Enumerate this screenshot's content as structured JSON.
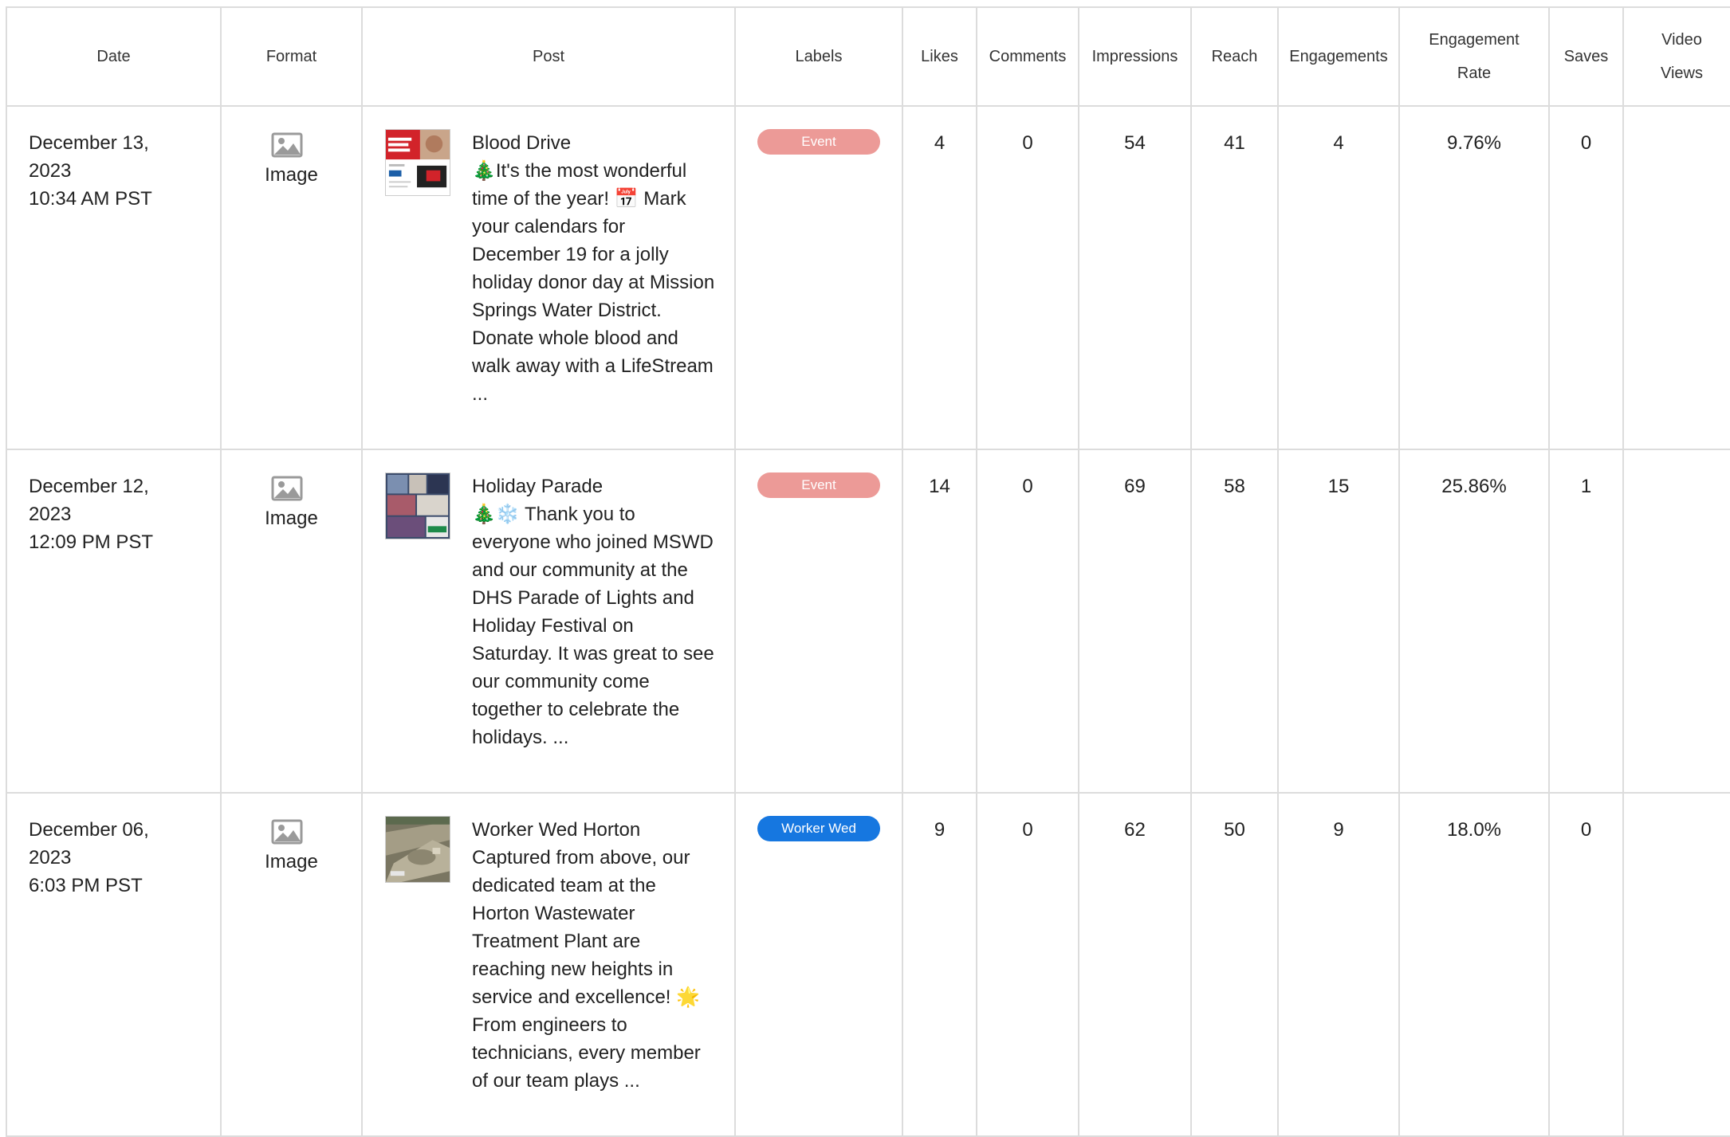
{
  "columns": {
    "date": "Date",
    "format": "Format",
    "post": "Post",
    "labels": "Labels",
    "likes": "Likes",
    "comments": "Comments",
    "impressions": "Impressions",
    "reach": "Reach",
    "engagements": "Engagements",
    "engagement_rate_line1": "Engagement",
    "engagement_rate_line2": "Rate",
    "saves": "Saves",
    "video_views_line1": "Video",
    "video_views_line2": "Views"
  },
  "colors": {
    "event_badge": "#ec9a97",
    "worker_wed_badge": "#1677e0"
  },
  "rows": [
    {
      "date": "December 13,",
      "year": "2023",
      "time": "10:34 AM PST",
      "format_icon": "image-icon",
      "format": "Image",
      "post_title": "Blood Drive",
      "post_body": "🎄It's the most wonderful time of the year! 📅 Mark your calendars for December 19 for a jolly holiday donor day at Mission Springs Water District. Donate whole blood and walk away with a LifeStream ...",
      "label": "Event",
      "likes": "4",
      "comments": "0",
      "impressions": "54",
      "reach": "41",
      "engagements": "4",
      "engagement_rate": "9.76%",
      "saves": "0",
      "video_views": ""
    },
    {
      "date": "December 12,",
      "year": "2023",
      "time": "12:09 PM PST",
      "format_icon": "image-icon",
      "format": "Image",
      "post_title": "Holiday Parade",
      "post_body": "🎄❄️ Thank you to everyone who joined MSWD and our community at the DHS Parade of Lights and Holiday Festival on Saturday. It was great to see our community come together to celebrate the holidays. ...",
      "label": "Event",
      "likes": "14",
      "comments": "0",
      "impressions": "69",
      "reach": "58",
      "engagements": "15",
      "engagement_rate": "25.86%",
      "saves": "1",
      "video_views": ""
    },
    {
      "date": "December 06,",
      "year": "2023",
      "time": "6:03 PM PST",
      "format_icon": "image-icon",
      "format": "Image",
      "post_title": "Worker Wed Horton",
      "post_body": "Captured from above, our dedicated team at the Horton Wastewater Treatment Plant are reaching new heights in service and excellence! 🌟 From engineers to technicians, every member of our team plays ...",
      "label": "Worker Wed",
      "likes": "9",
      "comments": "0",
      "impressions": "62",
      "reach": "50",
      "engagements": "9",
      "engagement_rate": "18.0%",
      "saves": "0",
      "video_views": ""
    }
  ]
}
